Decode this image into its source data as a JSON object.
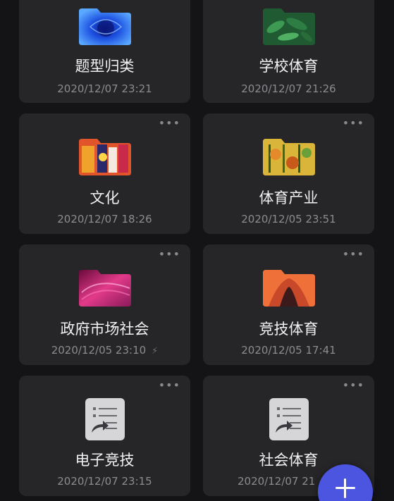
{
  "cards": [
    {
      "title": "题型归类",
      "date": "2020/12/07 23:21",
      "thumb": "blue-flower-folder"
    },
    {
      "title": "学校体育",
      "date": "2020/12/07 21:26",
      "thumb": "green-leaves-folder"
    },
    {
      "title": "文化",
      "date": "2020/12/07 18:26",
      "thumb": "colorful-painting-folder"
    },
    {
      "title": "体育产业",
      "date": "2020/12/05 23:51",
      "thumb": "autumn-forest-folder"
    },
    {
      "title": "政府市场社会",
      "date": "2020/12/05 23:10",
      "thumb": "pink-swirl-folder"
    },
    {
      "title": "竞技体育",
      "date": "2020/12/05 17:41",
      "thumb": "orange-hair-folder"
    },
    {
      "title": "电子竞技",
      "date": "2020/12/07 23:15",
      "thumb": "shared-note-icon"
    },
    {
      "title": "社会体育",
      "date": "2020/12/07 21",
      "thumb": "shared-note-icon"
    }
  ],
  "more_label": "•••",
  "sync_icon": "⚡",
  "colors": {
    "background": "#141416",
    "card": "#262628",
    "accent": "#4b55e0"
  }
}
